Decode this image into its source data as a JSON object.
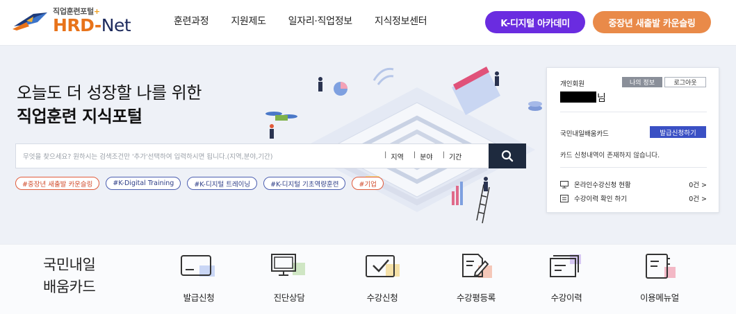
{
  "logo": {
    "subtitle": "직업훈련포털",
    "plus": "+",
    "brand_hrd": "HRD-",
    "brand_net": "Net"
  },
  "nav": {
    "items": [
      "훈련과정",
      "지원제도",
      "일자리·직업정보",
      "지식정보센터"
    ],
    "kdigital_label": "K-디지털 아카데미",
    "counseling_label": "중장년 새출발 카운슬링"
  },
  "hero": {
    "title_line1": "오늘도 더 성장할 나를 위한",
    "title_line2": "직업훈련 지식포털"
  },
  "search": {
    "placeholder": "무엇을 찾으세요? 원하시는 검색조건만 '추가'선택하여 입력하시면 됩니다.(지역,분야,기간)",
    "filters": [
      "지역",
      "분야",
      "기간"
    ]
  },
  "tags": [
    "#중장년 새출발 카운슬링",
    "#K-Digital Training",
    "#K-디지털 트레이닝",
    "#K-디지털 기초역량훈련",
    "#기업"
  ],
  "login_card": {
    "member_type": "개인회원",
    "my_info": "나의 정보",
    "logout": "로그아웃",
    "name_suffix": "님",
    "card_label": "국민내일배움카드",
    "issue_button": "발급신청하기",
    "no_card_msg": "카드 신청내역이 존재하지 않습니다.",
    "rows": [
      {
        "label": "온라인수강신청 현황",
        "count": "0건 >"
      },
      {
        "label": "수강이력 확인 하기",
        "count": "0건 >"
      }
    ]
  },
  "bottom": {
    "title_line1": "국민내일",
    "title_line2": "배움카드",
    "menu": [
      "발급신청",
      "진단상담",
      "수강신청",
      "수강평등록",
      "수강이력",
      "이용메뉴얼"
    ]
  },
  "colors": {
    "accent_purple": "#6a2ce0",
    "accent_orange": "#e98a49",
    "search_btn": "#1e2a3e",
    "issue_blue": "#3a50c4"
  }
}
